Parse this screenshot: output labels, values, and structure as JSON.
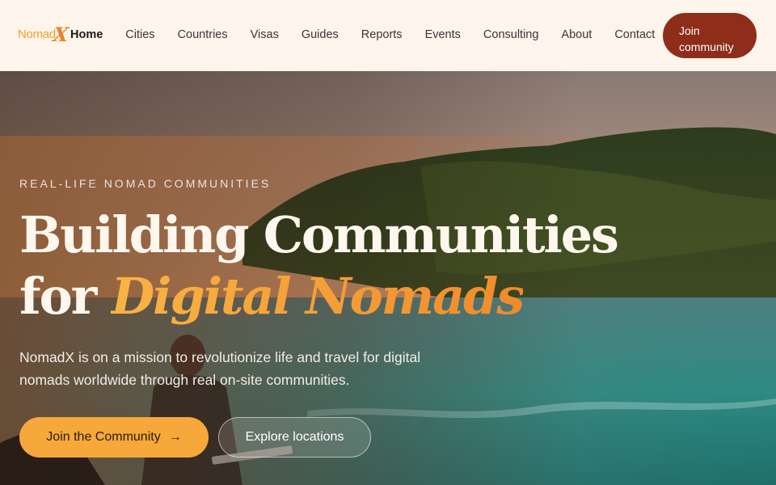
{
  "brand": {
    "name": "Nomad",
    "mark": "X",
    "colors": {
      "primary": "#f0a226",
      "cta": "#8f2d1b",
      "accent": "#f6a83a"
    }
  },
  "nav": {
    "links": [
      "Home",
      "Cities",
      "Countries",
      "Visas",
      "Guides",
      "Reports",
      "Events",
      "Consulting",
      "About",
      "Contact"
    ],
    "active": "Home",
    "join_label_line1": "Join",
    "join_label_line2": "community"
  },
  "hero": {
    "eyebrow": "REAL-LIFE NOMAD COMMUNITIES",
    "headline_line1": "Building Communities",
    "headline_for": "for",
    "headline_accent": "Digital Nomads",
    "subtitle": "NomadX is on a mission to revolutionize life and travel for digital nomads worldwide through real on-site communities.",
    "primary_cta": "Join the Community",
    "primary_cta_icon": "arrow-right-icon",
    "secondary_cta": "Explore locations"
  }
}
